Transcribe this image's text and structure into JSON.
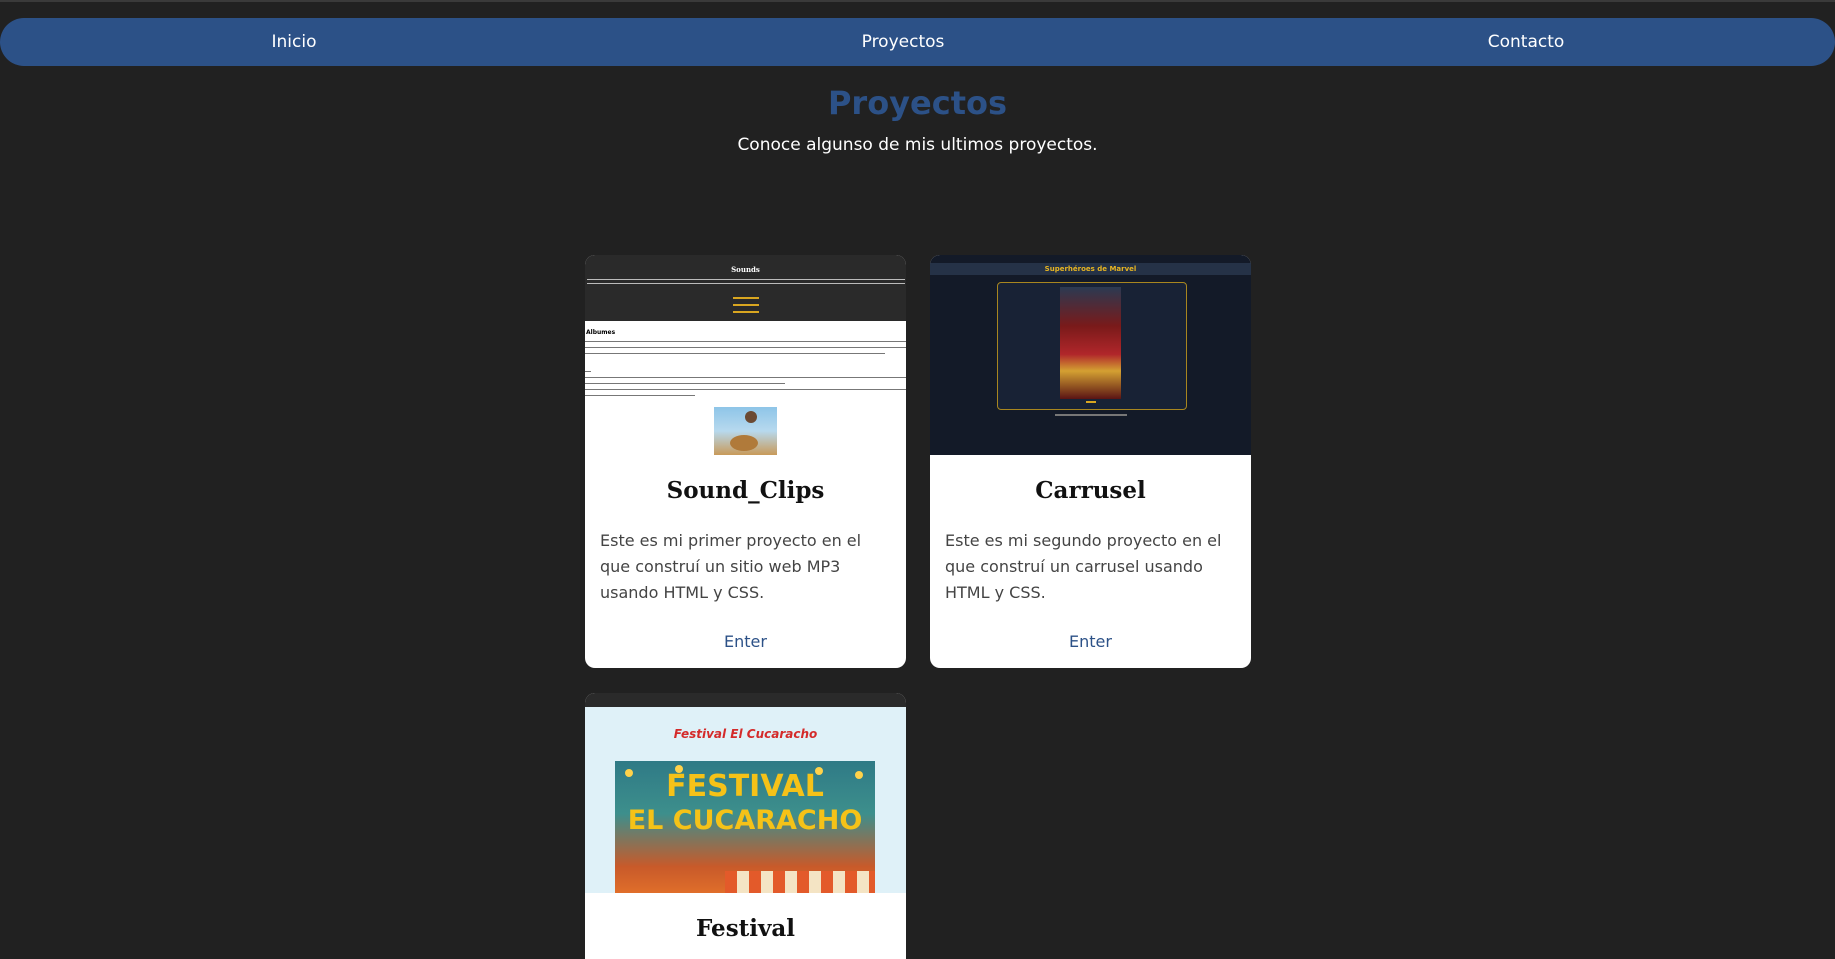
{
  "nav": {
    "items": [
      "Inicio",
      "Proyectos",
      "Contacto"
    ]
  },
  "hero": {
    "title": "Proyectos",
    "subtitle": "Conoce algunso de mis ultimos proyectos."
  },
  "projects": [
    {
      "title": "Sound_Clips",
      "description": "Este es mi primer proyecto en el que construí un sitio web MP3 usando HTML y CSS.",
      "link": "Enter",
      "preview": {
        "heading": "Sounds",
        "section": "Albumes"
      }
    },
    {
      "title": "Carrusel",
      "description": "Este es mi segundo proyecto en el que construí un carrusel usando HTML y CSS.",
      "link": "Enter",
      "preview": {
        "heading": "Superhéroes de Marvel"
      }
    },
    {
      "title": "Festival",
      "preview": {
        "heading": "Festival El Cucaracho",
        "poster_line1": "FESTIVAL",
        "poster_line2": "EL CUCARACHO"
      }
    }
  ],
  "colors": {
    "background": "#212121",
    "accent": "#2c5187",
    "card": "#ffffff"
  }
}
